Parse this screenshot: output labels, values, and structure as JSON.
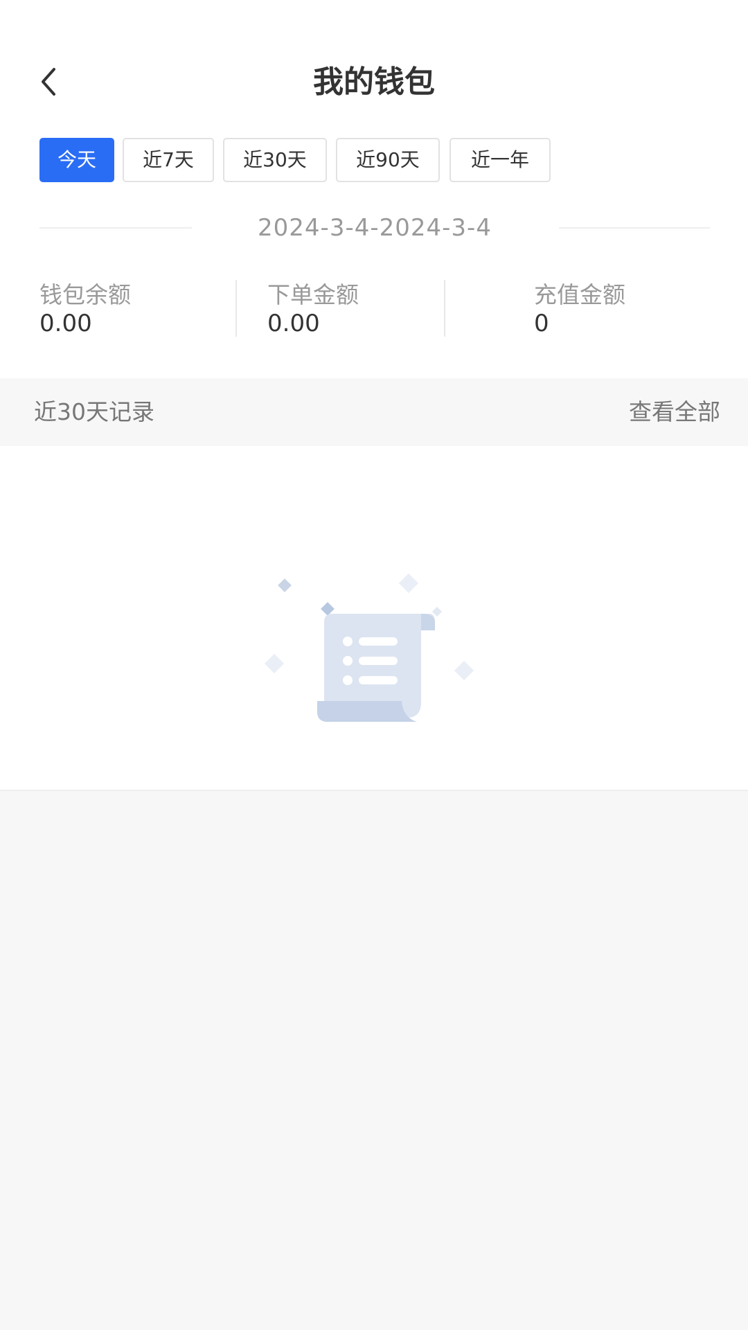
{
  "header": {
    "title": "我的钱包",
    "back_icon": "chevron-left-icon"
  },
  "tabs": [
    {
      "label": "今天",
      "active": true
    },
    {
      "label": "近7天",
      "active": false
    },
    {
      "label": "近30天",
      "active": false
    },
    {
      "label": "近90天",
      "active": false
    },
    {
      "label": "近一年",
      "active": false
    }
  ],
  "date_range": "2024-3-4-2024-3-4",
  "stats": [
    {
      "label": "钱包余额",
      "value": "0.00"
    },
    {
      "label": "下单金额",
      "value": "0.00"
    },
    {
      "label": "充值金额",
      "value": "0"
    }
  ],
  "records": {
    "title": "近30天记录",
    "view_all_label": "查看全部",
    "empty_icon": "empty-document-icon"
  },
  "colors": {
    "accent": "#2a6df5",
    "page_background": "#f7f7f7",
    "muted_text": "#999999"
  }
}
